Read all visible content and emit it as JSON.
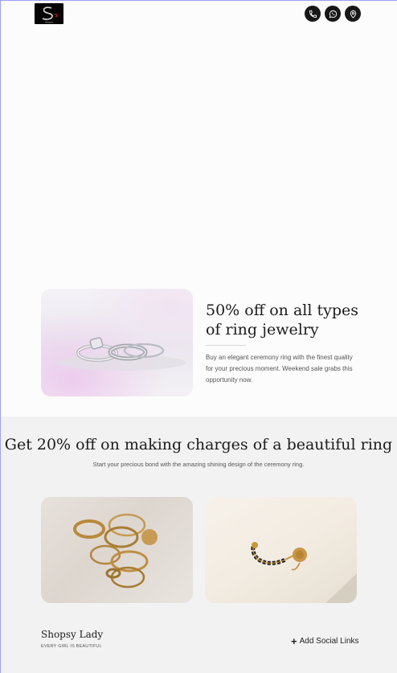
{
  "header": {
    "logo_text": "Shopsy",
    "icons": [
      "phone-icon",
      "whatsapp-icon",
      "location-pin-icon"
    ]
  },
  "promo": {
    "title": "50% off on all types of ring jewelry",
    "description": "Buy an elegant ceremony ring with the finest quality for your precious moment. Weekend sale grabs this opportunity now."
  },
  "offer": {
    "title": "Get 20% off on making charges of a beautiful ring",
    "subtitle": "Start your precious bond with the amazing shining design of the ceremony ring."
  },
  "footer": {
    "brand": "Shopsy Lady",
    "tagline": "EVERY GIRL IS BEAUTIFUL",
    "social_label": "Add Social Links",
    "social_icon": "plus-icon"
  },
  "colors": {
    "page_bg": "#fdfcfc",
    "band_bg": "#f3f2f2",
    "icon_bg": "#171717"
  }
}
